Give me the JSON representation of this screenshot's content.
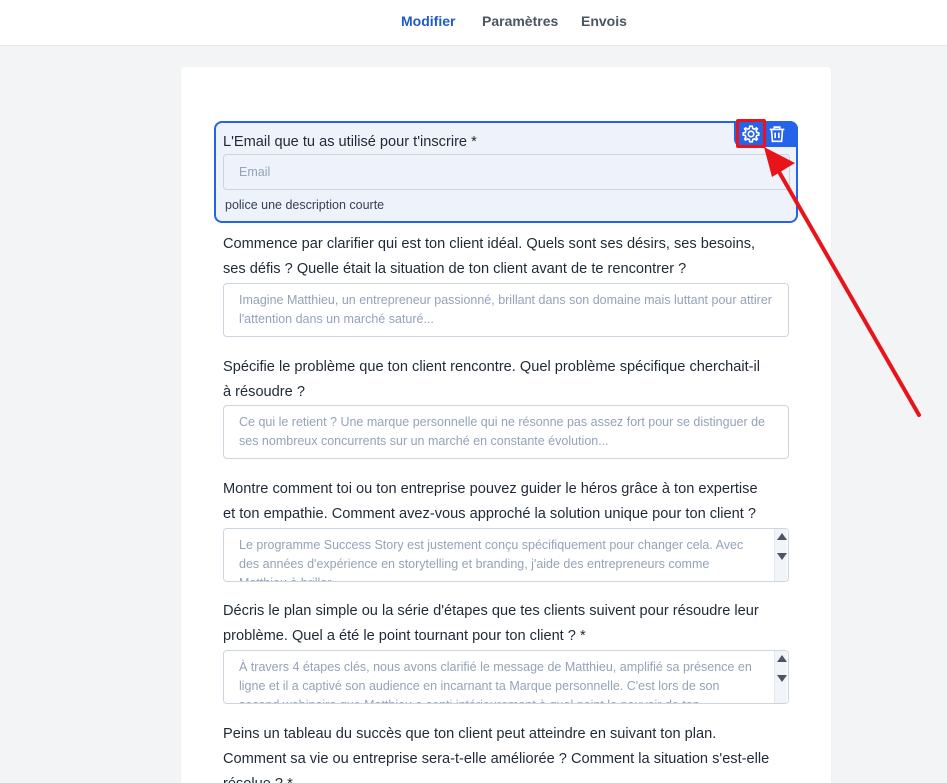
{
  "tabs": [
    {
      "label": "Modifier",
      "active": true
    },
    {
      "label": "Paramètres",
      "active": false
    },
    {
      "label": "Envois",
      "active": false
    }
  ],
  "selected_field": {
    "label": "L'Email que tu as utilisé pour t'inscrire *",
    "placeholder": "Email",
    "description": "police une description courte",
    "actions": [
      "gear-icon",
      "trash-icon"
    ]
  },
  "questions": [
    {
      "label_line1": "Commence par clarifier qui est ton client idéal. Quels sont ses désirs, ses besoins,",
      "label_line2": "ses défis ? Quelle était la situation de ton client avant de te rencontrer ?",
      "placeholder": "Imagine Matthieu, un entrepreneur passionné, brillant dans son domaine mais luttant pour attirer l'attention dans un marché saturé..."
    },
    {
      "label_line1": "Spécifie le problème que ton client rencontre. Quel problème spécifique cherchait-il",
      "label_line2": "à résoudre ?",
      "placeholder": "Ce qui le retient ? Une marque personnelle qui ne résonne pas assez fort pour se distinguer de ses nombreux concurrents sur un marché en constante évolution..."
    },
    {
      "label_line1": "Montre comment toi ou ton entreprise pouvez guider le héros grâce à ton expertise",
      "label_line2": "et ton empathie. Comment avez-vous approché la solution unique pour ton client ?",
      "placeholder": "Le programme Success Story est justement conçu spécifiquement pour changer cela. Avec des années d'expérience en storytelling et branding, j'aide des entrepreneurs comme Matthieu à briller..."
    },
    {
      "label_line1": "Décris le plan simple ou la série d'étapes que tes clients suivent pour résoudre leur",
      "label_line2": "problème. Quel a été le point tournant pour ton client ? *",
      "placeholder": "À travers 4 étapes clés, nous avons clarifié le message de Matthieu, amplifié sa présence en ligne et il a captivé son audience en incarnant ta Marque personnelle. C'est lors de son second webinaire que Matthieu a senti intérieurement à quel point le pouvoir de ton..."
    },
    {
      "label_line1": "Peins un tableau du succès que ton client peut atteindre en suivant ton plan.",
      "label_line2": "Comment sa vie ou entreprise sera-t-elle améliorée ? Comment la situation s'est-elle",
      "label_line3": "résolue ? *"
    }
  ],
  "colors": {
    "accent": "#2563eb",
    "active_tab": "#1e5bc6",
    "annotation": "#e8141a"
  }
}
